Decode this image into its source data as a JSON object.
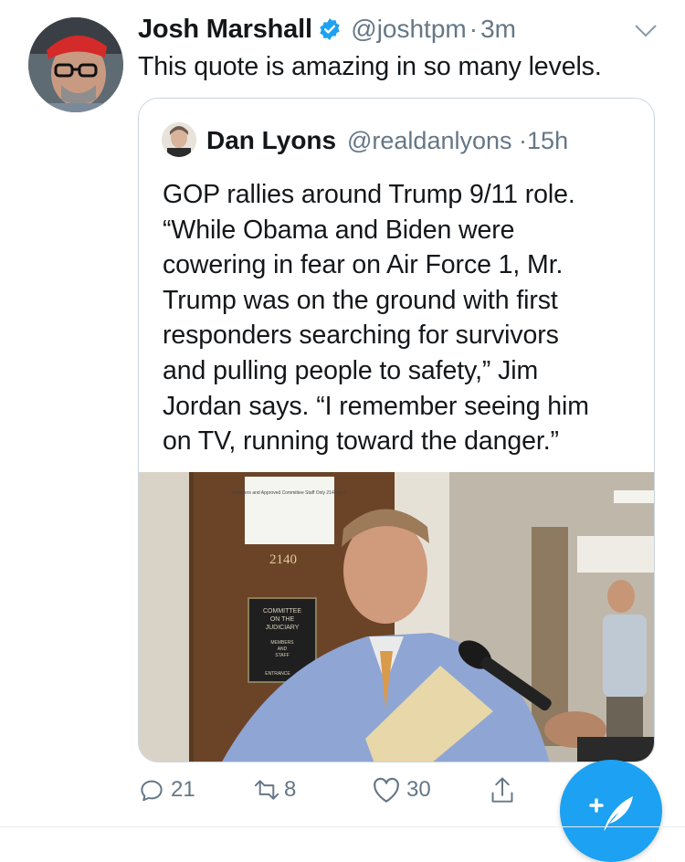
{
  "tweet": {
    "author_name": "Josh Marshall",
    "author_handle": "@joshtpm",
    "separator": "·",
    "time": "3m",
    "text": "This quote is amazing in so many levels.",
    "avatar_icon": "user-avatar-photo",
    "verified_icon": "verified-badge-icon",
    "menu_icon": "chevron-down-icon"
  },
  "quoted": {
    "author_name": "Dan Lyons",
    "author_handle": "@realdanlyons",
    "separator": "·",
    "time": "15h",
    "text": "GOP rallies around Trump 9/11 role.\n“While Obama and Biden were\ncowering in fear on Air Force 1, Mr.\nTrump was on the ground with first\nresponders searching for survivors\nand pulling people to safety,” Jim\nJordan says. “I remember seeing him\non TV, running toward the danger.”",
    "image": {
      "door_sign": "Members and Approved Committee Staff Only 2140 door",
      "room_number": "2140",
      "plaque_lines": [
        "COMMITTEE",
        "ON THE",
        "JUDICIARY"
      ],
      "plaque_small": [
        "MEMBERS",
        "AND",
        "STAFF",
        "ENTRANCE"
      ]
    }
  },
  "actions": {
    "reply_count": "21",
    "retweet_count": "8",
    "like_count": "30",
    "reply_icon": "reply-icon",
    "retweet_icon": "retweet-icon",
    "like_icon": "heart-icon",
    "share_icon": "share-icon"
  },
  "compose": {
    "icon": "compose-tweet-icon"
  },
  "colors": {
    "accent": "#1da1f2",
    "secondary_text": "#657786",
    "border": "#ccd6dd"
  }
}
